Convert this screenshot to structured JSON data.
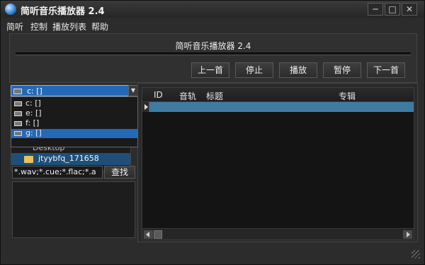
{
  "window": {
    "title": "简听音乐播放器 2.4",
    "controls": {
      "minimize": "─",
      "maximize": "□",
      "close": "✕"
    }
  },
  "menu": [
    "简听",
    "控制",
    "播放列表",
    "帮助"
  ],
  "player": {
    "title": "简听音乐播放器 2.4",
    "buttons": [
      "上一首",
      "停止",
      "播放",
      "暂停",
      "下一首"
    ]
  },
  "browser": {
    "drive_selected": "c: []",
    "drive_options": [
      "c: []",
      "e: []",
      "f: []",
      "g: []"
    ],
    "highlighted_option": "g: []",
    "tree": {
      "desktop": "Desktop",
      "selected_folder": "jtyybfq_171658"
    },
    "filter_value": "*.wav;*.cue;*.flac;*.a",
    "search_label": "查找"
  },
  "playlist": {
    "columns": [
      "ID",
      "音轨",
      "标题",
      "专辑"
    ]
  },
  "icons": {
    "app": "app-logo-icon",
    "drive": "drive-icon",
    "folder": "folder-icon",
    "dropdown": "chevron-down-icon"
  },
  "colors": {
    "selection": "#2469b6",
    "row_highlight": "#3f7aa1",
    "background": "#2c2c2c"
  }
}
